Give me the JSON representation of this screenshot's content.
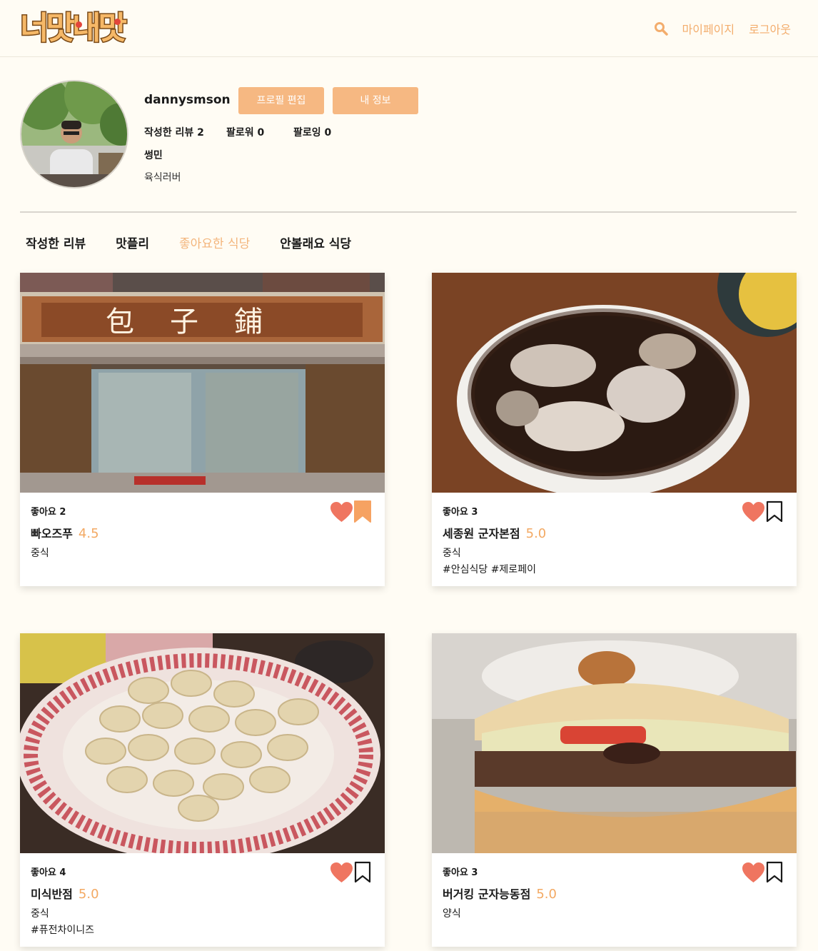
{
  "app": {
    "logo_text": "너맛내맛",
    "theme": {
      "accent": "#f6b882",
      "accent_text": "#f3ad6d",
      "rating": "#f3a963",
      "heart": "#ef7560",
      "background": "#fffcf4"
    }
  },
  "header": {
    "search_icon": "search-icon",
    "mypage_label": "마이페이지",
    "logout_label": "로그아웃"
  },
  "profile": {
    "username": "dannysmson",
    "edit_profile_label": "프로필 편집",
    "my_info_label": "내 정보",
    "review_count_text": "작성한 리뷰 2",
    "followers_text": "팔로워 0",
    "following_text": "팔로잉 0",
    "nickname": "썽민",
    "bio": "육식러버"
  },
  "tabs": [
    {
      "label": "작성한 리뷰",
      "active": false
    },
    {
      "label": "맛플리",
      "active": false
    },
    {
      "label": "좋아요한 식당",
      "active": true
    },
    {
      "label": "안볼래요 식당",
      "active": false
    }
  ],
  "restaurants": [
    {
      "likes_text": "좋아요 2",
      "name": "빠오즈푸",
      "rating": "4.5",
      "category": "중식",
      "tags": "",
      "liked": true,
      "bookmarked": true,
      "image_icon": "restaurant-storefront-photo"
    },
    {
      "likes_text": "좋아요 3",
      "name": "세종원 군자본점",
      "rating": "5.0",
      "category": "중식",
      "tags": "#안심식당 #제로페이",
      "liked": true,
      "bookmarked": false,
      "image_icon": "jajangmyeon-photo"
    },
    {
      "likes_text": "좋아요 4",
      "name": "미식반점",
      "rating": "5.0",
      "category": "중식",
      "tags": "#퓨전차이니즈",
      "liked": true,
      "bookmarked": false,
      "image_icon": "dumplings-photo"
    },
    {
      "likes_text": "좋아요 3",
      "name": "버거킹 군자능동점",
      "rating": "5.0",
      "category": "양식",
      "tags": "",
      "liked": true,
      "bookmarked": false,
      "image_icon": "burger-photo"
    }
  ]
}
